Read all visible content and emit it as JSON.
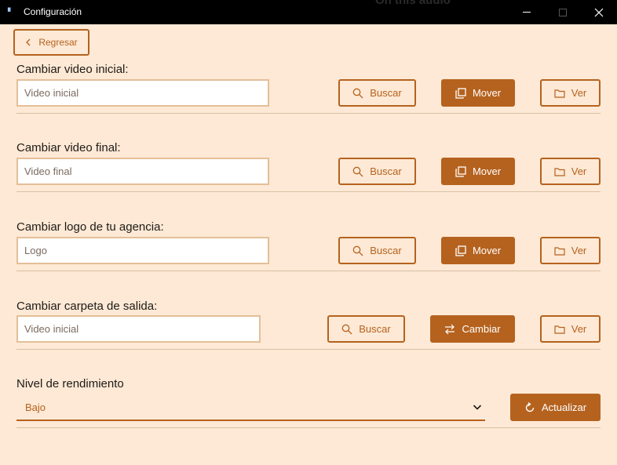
{
  "window": {
    "title": "Configuración",
    "ghost_text": "On this audio"
  },
  "back_button": {
    "label": "Regresar"
  },
  "sections": [
    {
      "label": "Cambiar video inicial:",
      "input_placeholder": "Video inicial",
      "search_label": "Buscar",
      "action_label": "Mover",
      "view_label": "Ver"
    },
    {
      "label": "Cambiar video final:",
      "input_placeholder": "Video final",
      "search_label": "Buscar",
      "action_label": "Mover",
      "view_label": "Ver"
    },
    {
      "label": "Cambiar logo de tu agencia:",
      "input_placeholder": "Logo",
      "search_label": "Buscar",
      "action_label": "Mover",
      "view_label": "Ver"
    },
    {
      "label": "Cambiar carpeta de salida:",
      "input_placeholder": "Video inicial",
      "search_label": "Buscar",
      "action_label": "Cambiar",
      "view_label": "Ver"
    }
  ],
  "performance": {
    "label": "Nivel de rendimiento",
    "selected": "Bajo",
    "update_label": "Actualizar"
  },
  "colors": {
    "background": "#fde9d5",
    "accent": "#b5621f",
    "input_border": "#e4bf98",
    "titlebar": "#000000"
  },
  "icons": {
    "back": "chevron-left-icon",
    "search": "search-icon",
    "move": "copy-icon",
    "change": "swap-icon",
    "view": "folder-icon",
    "dropdown": "chevron-down-icon",
    "refresh": "refresh-icon"
  }
}
